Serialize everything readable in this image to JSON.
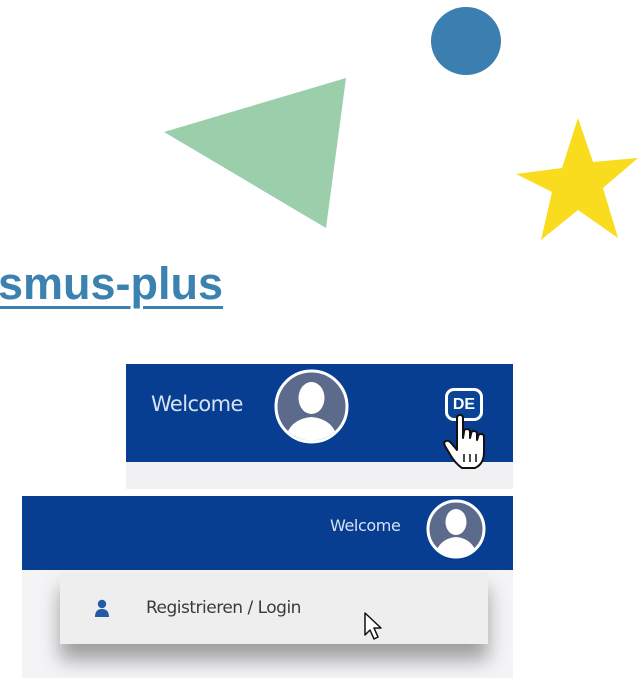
{
  "decorations": {
    "circle_color": "#3a7fb0",
    "triangle_color": "#9bcfac",
    "star_color": "#f9dc1d"
  },
  "headline": {
    "text": "smus-plus",
    "color": "#3b82b0"
  },
  "header_panel_1": {
    "welcome_text": "Welcome",
    "avatar_icon": "user-avatar-icon",
    "language_badge": "DE",
    "cursor_icon": "hand-pointer-icon",
    "bar_color": "#073e92"
  },
  "header_panel_2": {
    "welcome_text": "Welcome",
    "avatar_icon": "user-avatar-icon",
    "dropdown": {
      "items": [
        {
          "icon": "person-icon",
          "label": "Registrieren / Login"
        }
      ]
    },
    "cursor_icon": "arrow-cursor-icon",
    "bar_color": "#073e92"
  }
}
